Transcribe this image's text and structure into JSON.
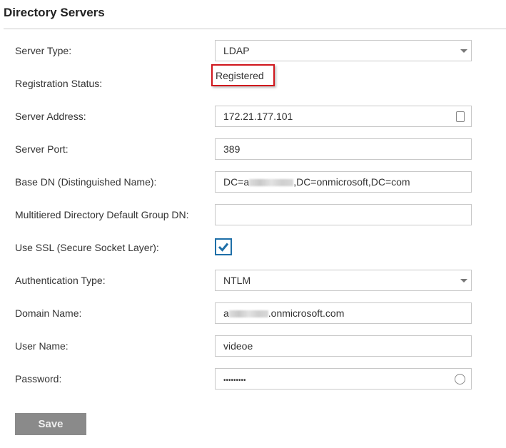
{
  "title": "Directory Servers",
  "fields": {
    "server_type": {
      "label": "Server Type:",
      "value": "LDAP"
    },
    "registration_status": {
      "label": "Registration Status:",
      "value": "Registered"
    },
    "server_address": {
      "label": "Server Address:",
      "value": "172.21.177.101"
    },
    "server_port": {
      "label": "Server Port:",
      "value": "389"
    },
    "base_dn": {
      "label": "Base DN (Distinguished Name):",
      "prefix": "DC=a",
      "suffix": ",DC=onmicrosoft,DC=com"
    },
    "group_dn": {
      "label": "Multitiered Directory Default Group DN:",
      "value": ""
    },
    "use_ssl": {
      "label": "Use SSL (Secure Socket Layer):",
      "checked": true
    },
    "auth_type": {
      "label": "Authentication Type:",
      "value": "NTLM"
    },
    "domain_name": {
      "label": "Domain Name:",
      "prefix": "a",
      "suffix": ".onmicrosoft.com"
    },
    "user_name": {
      "label": "User Name:",
      "value": "videoe"
    },
    "password": {
      "label": "Password:",
      "value": "•••••••••"
    }
  },
  "save_label": "Save"
}
